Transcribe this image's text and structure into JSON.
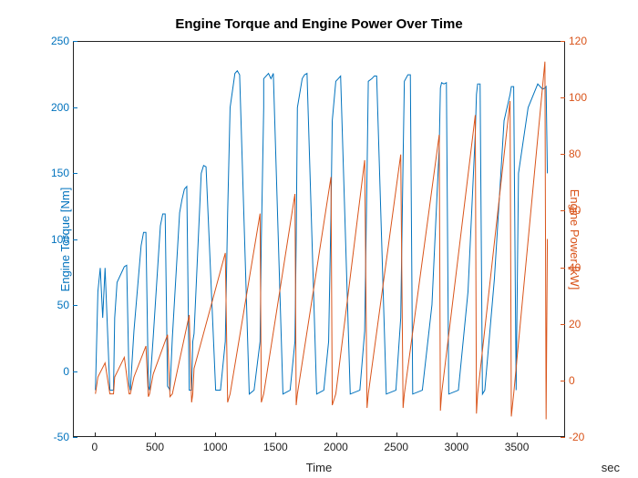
{
  "chart_data": {
    "type": "line",
    "title": "Engine Torque and Engine Power Over Time",
    "xlabel": "Time",
    "xunit": "sec",
    "xlim": [
      -180,
      3900
    ],
    "left_axis": {
      "label": "Engine Torque [Nm]",
      "color": "#0072BD",
      "ylim": [
        -50,
        250
      ],
      "ticks": [
        -50,
        0,
        50,
        100,
        150,
        200,
        250
      ]
    },
    "right_axis": {
      "label": "Engine Power [kW]",
      "color": "#D95319",
      "ylim": [
        -20,
        120
      ],
      "ticks": [
        -20,
        0,
        20,
        40,
        60,
        80,
        100,
        120
      ]
    },
    "x_ticks": [
      0,
      500,
      1000,
      1500,
      2000,
      2500,
      3000,
      3500
    ],
    "series": [
      {
        "name": "Engine Torque [Nm]",
        "axis": "left",
        "color": "#0072BD",
        "x": [
          0,
          20,
          40,
          60,
          80,
          120,
          150,
          160,
          180,
          240,
          260,
          280,
          290,
          320,
          380,
          400,
          420,
          440,
          450,
          480,
          540,
          560,
          580,
          600,
          620,
          640,
          700,
          720,
          740,
          760,
          780,
          800,
          810,
          820,
          880,
          900,
          920,
          1000,
          1040,
          1080,
          1100,
          1120,
          1160,
          1180,
          1200,
          1280,
          1320,
          1370,
          1380,
          1400,
          1400,
          1440,
          1460,
          1480,
          1560,
          1620,
          1660,
          1670,
          1680,
          1720,
          1740,
          1760,
          1840,
          1900,
          1940,
          1960,
          1970,
          2000,
          2020,
          2040,
          2120,
          2200,
          2240,
          2260,
          2270,
          2300,
          2320,
          2340,
          2420,
          2500,
          2540,
          2560,
          2570,
          2600,
          2620,
          2640,
          2720,
          2800,
          2860,
          2870,
          2880,
          2900,
          2920,
          2940,
          3020,
          3100,
          3160,
          3170,
          3180,
          3200,
          3220,
          3240,
          3320,
          3400,
          3450,
          3460,
          3480,
          3500,
          3520,
          3600,
          3680,
          3720,
          3740,
          3750,
          3760
        ],
        "y": [
          -15,
          60,
          78,
          40,
          78,
          -15,
          -15,
          40,
          67,
          79,
          80,
          -10,
          -15,
          30,
          95,
          105,
          105,
          -12,
          -15,
          25,
          110,
          119,
          119,
          -12,
          -15,
          25,
          120,
          130,
          138,
          140,
          -15,
          -15,
          22,
          28,
          150,
          156,
          155,
          -15,
          -15,
          22,
          120,
          200,
          226,
          228,
          225,
          -18,
          -15,
          22,
          100,
          200,
          222,
          226,
          222,
          226,
          -18,
          -15,
          22,
          100,
          200,
          222,
          225,
          226,
          -18,
          -15,
          22,
          120,
          190,
          220,
          222,
          224,
          -18,
          -15,
          30,
          150,
          220,
          222,
          224,
          224,
          -18,
          -15,
          40,
          160,
          220,
          225,
          225,
          -18,
          -15,
          50,
          170,
          215,
          219,
          218,
          219,
          -18,
          -15,
          60,
          180,
          210,
          218,
          218,
          -18,
          -15,
          70,
          190,
          210,
          216,
          216,
          -15,
          150,
          200,
          218,
          214,
          215,
          216,
          150
        ]
      },
      {
        "name": "Engine Power [kW]",
        "axis": "right",
        "color": "#D95319",
        "x": [
          0,
          20,
          80,
          120,
          150,
          160,
          240,
          280,
          290,
          320,
          420,
          440,
          450,
          480,
          600,
          620,
          640,
          780,
          800,
          810,
          820,
          1080,
          1100,
          1120,
          1370,
          1380,
          1400,
          1660,
          1670,
          1680,
          1960,
          1970,
          2000,
          2240,
          2260,
          2270,
          2540,
          2560,
          2570,
          2860,
          2870,
          2880,
          3160,
          3170,
          3180,
          3450,
          3460,
          3480,
          3740,
          3750,
          3760
        ],
        "y": [
          -5,
          1,
          6,
          -5,
          -5,
          1,
          8,
          -5,
          -5,
          1,
          12,
          -6,
          -5,
          2,
          16,
          -6,
          -5,
          23,
          -8,
          -5,
          4,
          45,
          -8,
          -5,
          59,
          -8,
          -5,
          66,
          -9,
          -5,
          72,
          -9,
          -5,
          78,
          -10,
          -5,
          80,
          -10,
          -5,
          87,
          -11,
          -5,
          94,
          -12,
          -5,
          99,
          -13,
          -5,
          113,
          -14,
          50
        ]
      }
    ]
  }
}
